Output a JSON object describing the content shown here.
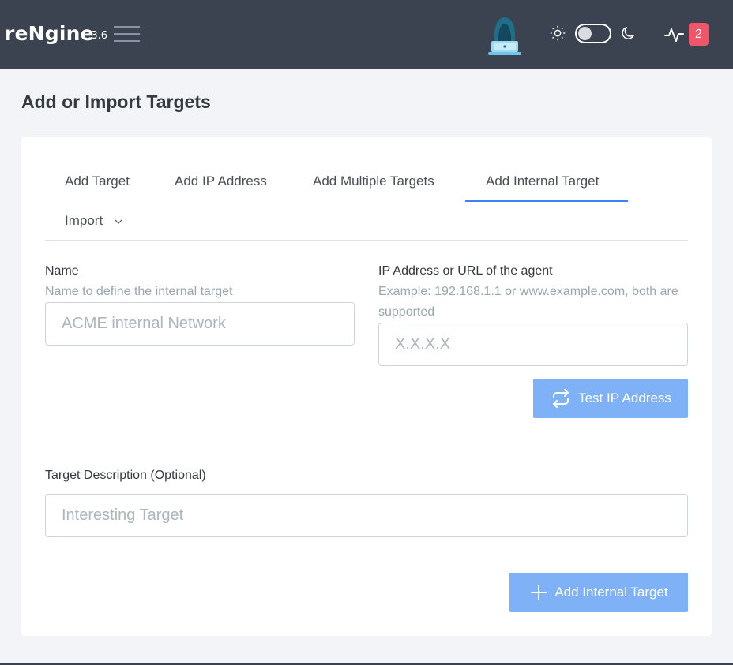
{
  "header": {
    "brand": "reNgine",
    "version": "1.3.6",
    "notification_count": "2"
  },
  "page": {
    "title": "Add or Import Targets"
  },
  "tabs": [
    {
      "label": "Add Target",
      "active": false
    },
    {
      "label": "Add IP Address",
      "active": false
    },
    {
      "label": "Add Multiple Targets",
      "active": false
    },
    {
      "label": "Add Internal Target",
      "active": true
    },
    {
      "label": "Import",
      "active": false,
      "dropdown": true
    }
  ],
  "form": {
    "name_label": "Name",
    "name_hint": "Name to define the internal target",
    "name_placeholder": "ACME internal Network",
    "ip_label": "IP Address or URL of the agent",
    "ip_hint": "Example: 192.168.1.1 or www.example.com, both are supported",
    "ip_placeholder": "X.X.X.X",
    "test_button": "Test IP Address",
    "description_label": "Target Description (Optional)",
    "description_placeholder": "Interesting Target",
    "submit_button": "Add Internal Target"
  },
  "colors": {
    "topbar": "#3b4350",
    "accent": "#3b82f6",
    "button": "#7fb1f7",
    "badge": "#f0566a"
  }
}
